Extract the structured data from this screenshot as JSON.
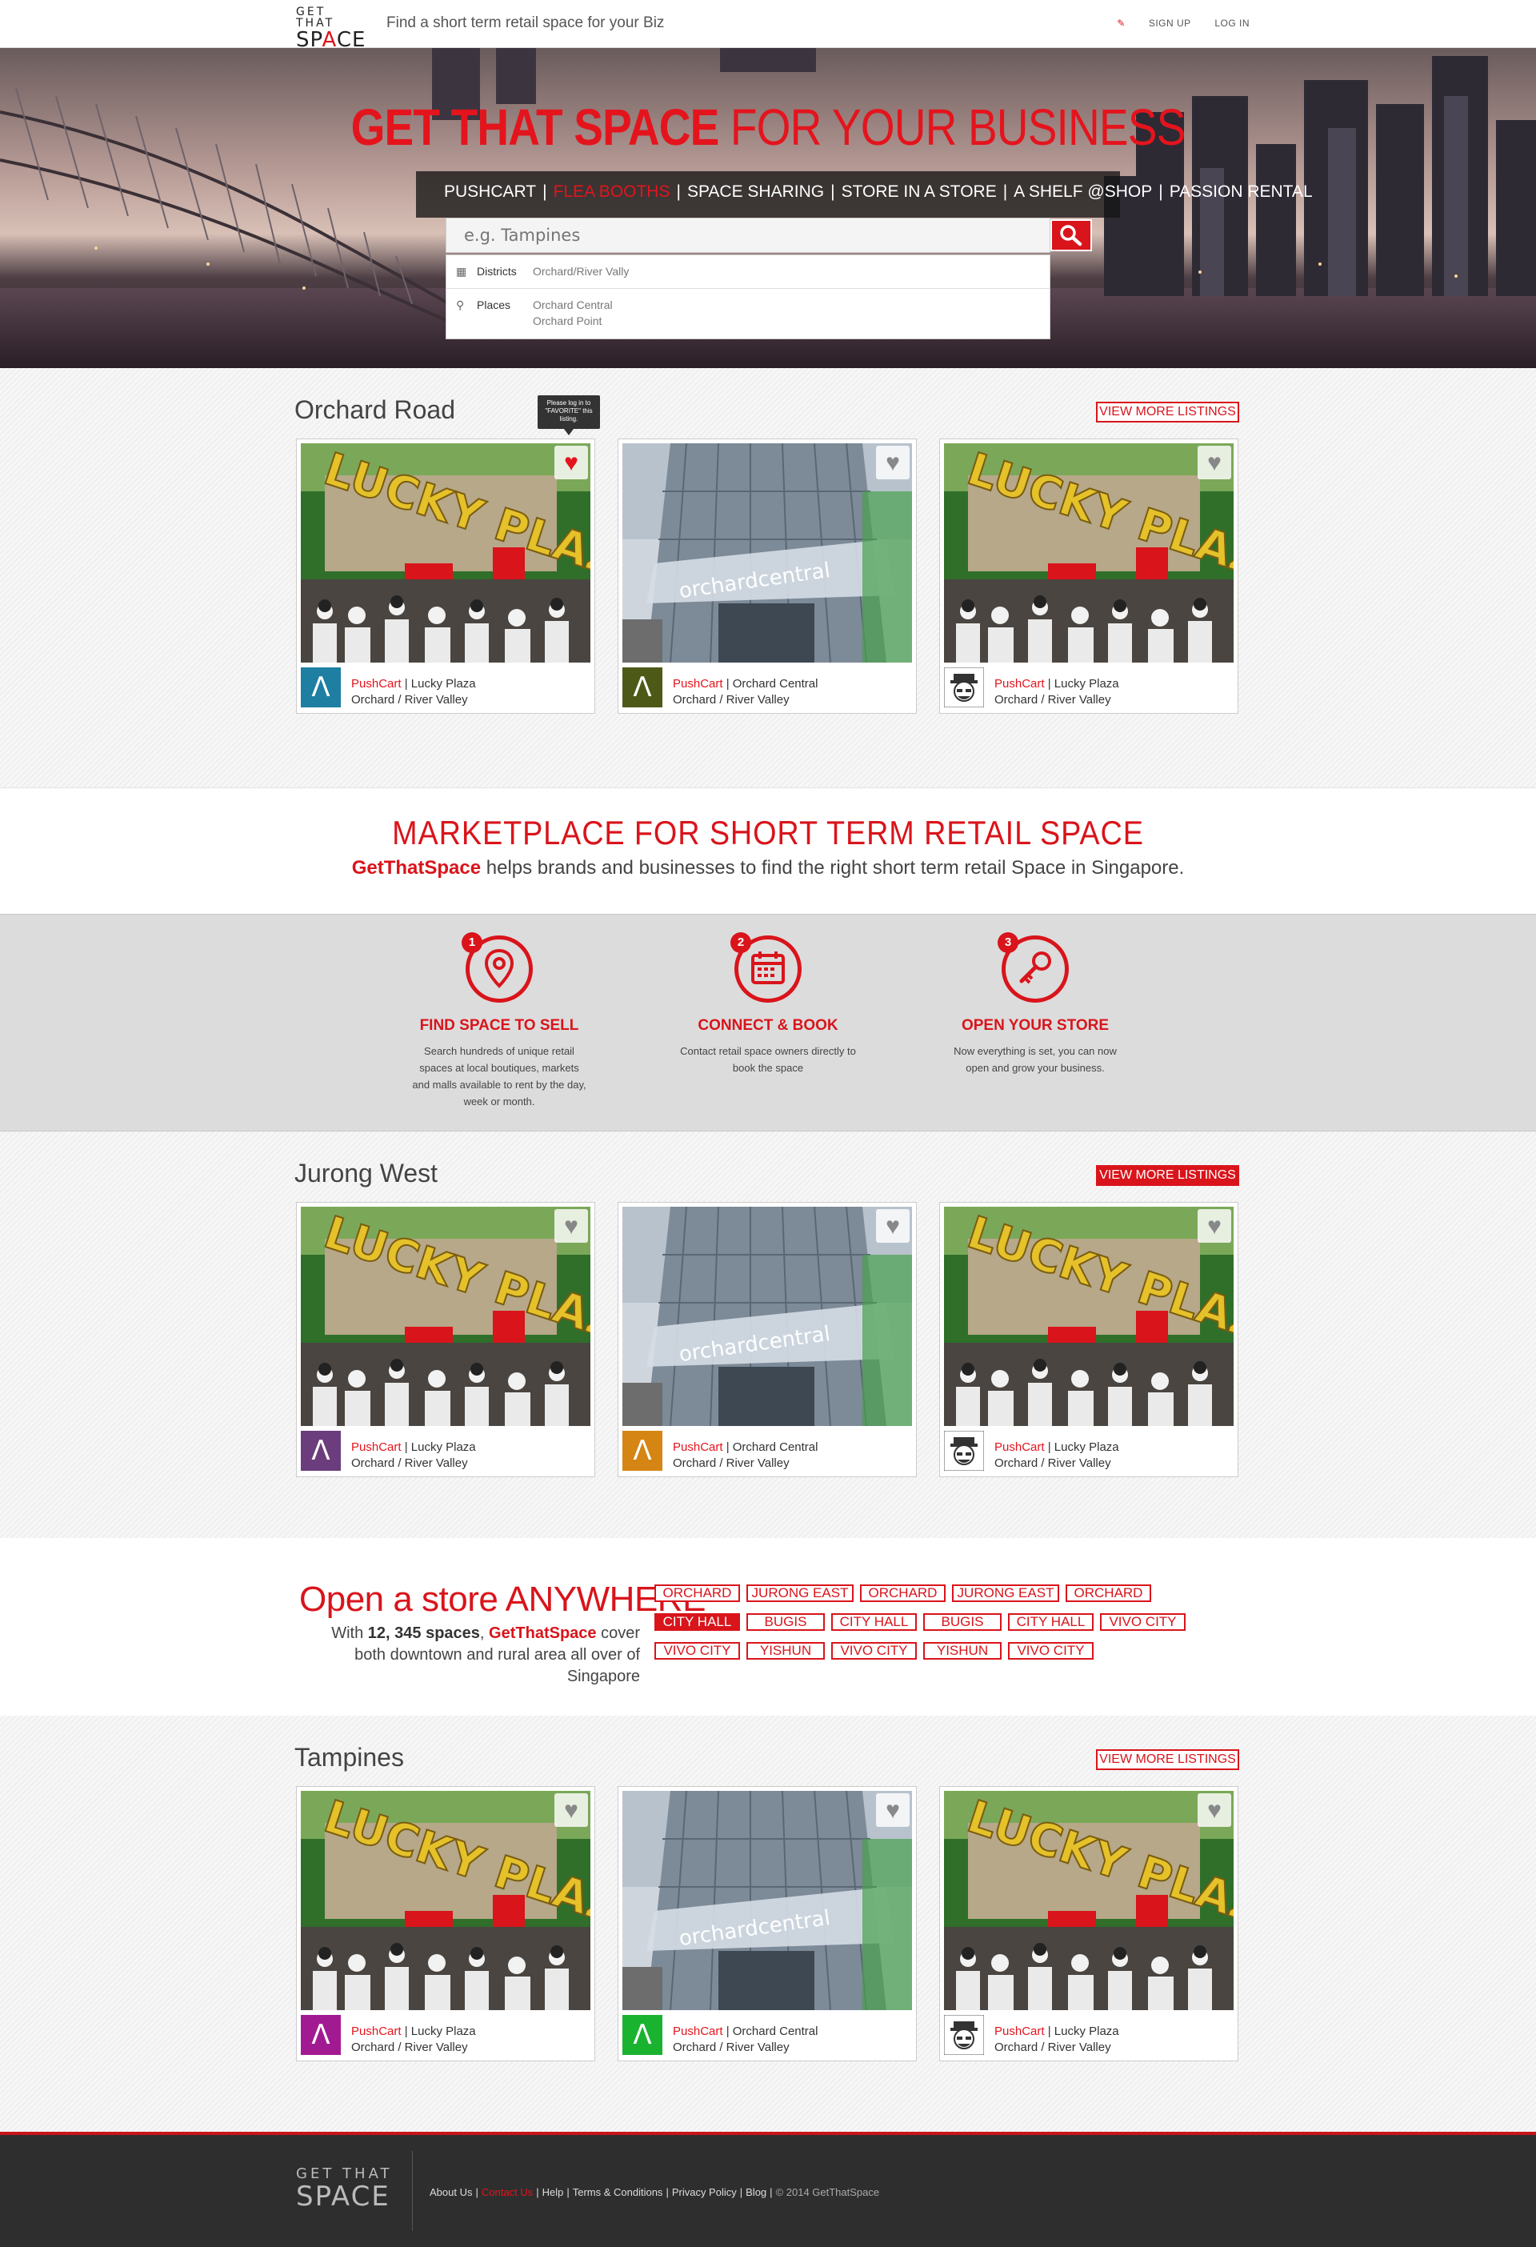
{
  "header": {
    "logo_top": "GET THAT",
    "logo_bottom_pre": "SP",
    "logo_bottom_accent": "A",
    "logo_bottom_post": "CE",
    "tagline": "Find a short term retail space for your Biz",
    "signup": "SIGN UP",
    "login": "LOG IN"
  },
  "hero": {
    "title_bold": "GET THAT SPACE",
    "title_rest": " FOR YOUR BUSINESS",
    "categories": [
      "PUSHCART",
      "FLEA BOOTHS",
      "SPACE SHARING",
      "STORE IN A STORE",
      "A SHELF @SHOP",
      "PASSION RENTAL"
    ],
    "active_category": "FLEA BOOTHS",
    "search_placeholder": "e.g. Tampines",
    "dropdown": {
      "districts_label": "Districts",
      "districts_value": "Orchard/River Vally",
      "places_label": "Places",
      "places_value_1": "Orchard Central",
      "places_value_2": "Orchard Point"
    }
  },
  "tooltip": "Please log in to \"FAVORITE\" this listing.",
  "sections": [
    {
      "title": "Orchard Road",
      "view_more": "VIEW MORE LISTINGS",
      "cards": [
        {
          "photo": "lucky-plaza",
          "category": "PushCart",
          "name": "Lucky Plaza",
          "area": "Orchard / River Valley",
          "avatar_color": "#1e7fa3",
          "avatar_type": "letter",
          "avatar_letter": "Λ",
          "favorited": true
        },
        {
          "photo": "orchard-central",
          "category": "PushCart",
          "name": "Orchard Central",
          "area": "Orchard / River Valley",
          "avatar_color": "#4d5a17",
          "avatar_type": "letter",
          "avatar_letter": "Λ",
          "favorited": false
        },
        {
          "photo": "lucky-plaza",
          "category": "PushCart",
          "name": "Lucky Plaza",
          "area": "Orchard / River Valley",
          "avatar_color": "#ffffff",
          "avatar_type": "face",
          "avatar_letter": "",
          "favorited": false
        }
      ]
    },
    {
      "title": "Jurong West",
      "view_more": "VIEW MORE LISTINGS",
      "cards": [
        {
          "photo": "lucky-plaza",
          "category": "PushCart",
          "name": "Lucky Plaza",
          "area": "Orchard / River Valley",
          "avatar_color": "#6b3d7c",
          "avatar_type": "letter",
          "avatar_letter": "Λ",
          "favorited": false
        },
        {
          "photo": "orchard-central",
          "category": "PushCart",
          "name": "Orchard Central",
          "area": "Orchard / River Valley",
          "avatar_color": "#d58513",
          "avatar_type": "letter",
          "avatar_letter": "Λ",
          "favorited": false
        },
        {
          "photo": "lucky-plaza",
          "category": "PushCart",
          "name": "Lucky Plaza",
          "area": "Orchard / River Valley",
          "avatar_color": "#ffffff",
          "avatar_type": "face",
          "avatar_letter": "",
          "favorited": false
        }
      ]
    },
    {
      "title": "Tampines",
      "view_more": "VIEW MORE LISTINGS",
      "cards": [
        {
          "photo": "lucky-plaza",
          "category": "PushCart",
          "name": "Lucky Plaza",
          "area": "Orchard / River Valley",
          "avatar_color": "#a21a92",
          "avatar_type": "letter",
          "avatar_letter": "Λ",
          "favorited": false
        },
        {
          "photo": "orchard-central",
          "category": "PushCart",
          "name": "Orchard Central",
          "area": "Orchard / River Valley",
          "avatar_color": "#19b330",
          "avatar_type": "letter",
          "avatar_letter": "Λ",
          "favorited": false
        },
        {
          "photo": "lucky-plaza",
          "category": "PushCart",
          "name": "Lucky Plaza",
          "area": "Orchard / River Valley",
          "avatar_color": "#ffffff",
          "avatar_type": "face",
          "avatar_letter": "",
          "favorited": false
        }
      ]
    }
  ],
  "marketplace": {
    "title": "MARKETPLACE FOR SHORT TERM RETAIL SPACE",
    "brand": "GetThatSpace",
    "subtitle_rest": " helps brands and businesses to find the right short term retail Space in Singapore."
  },
  "steps": [
    {
      "num": "1",
      "icon": "map-pin-icon",
      "title": "FIND SPACE TO SELL",
      "desc": "Search hundreds of unique retail spaces at local boutiques, markets and malls available to rent by the day, week or month."
    },
    {
      "num": "2",
      "icon": "calendar-icon",
      "title": "CONNECT & BOOK",
      "desc": "Contact retail space owners directly to book the space"
    },
    {
      "num": "3",
      "icon": "key-icon",
      "title": "OPEN YOUR STORE",
      "desc": "Now everything is set, you can now open and grow your business."
    }
  ],
  "anywhere": {
    "title": "Open a store ANYWHERE",
    "sub_pre": "With ",
    "sub_count": "12, 345 spaces",
    "sub_mid": ", ",
    "sub_brand": "GetThatSpace",
    "sub_post": " cover both downtown and rural area all over of Singapore",
    "tags": [
      [
        "ORCHARD",
        "JURONG EAST",
        "ORCHARD",
        "JURONG EAST",
        "ORCHARD"
      ],
      [
        "CITY HALL",
        "BUGIS",
        "CITY HALL",
        "BUGIS",
        "CITY HALL",
        "VIVO CITY"
      ],
      [
        "VIVO CITY",
        "YISHUN",
        "VIVO CITY",
        "YISHUN",
        "VIVO CITY"
      ]
    ],
    "active_tag": "CITY HALL"
  },
  "footer": {
    "logo_top": "GET THAT",
    "logo_bottom": "SPACE",
    "links": [
      "About Us",
      "Contact Us",
      "Help",
      "Terms & Conditions",
      "Privacy Policy",
      "Blog"
    ],
    "active_link": "Contact Us",
    "copyright": "© 2014 GetThatSpace"
  },
  "colors": {
    "brand_red": "#d9141b",
    "footer_bg": "#2e2e2e",
    "steps_bg": "#dcdcdc"
  }
}
